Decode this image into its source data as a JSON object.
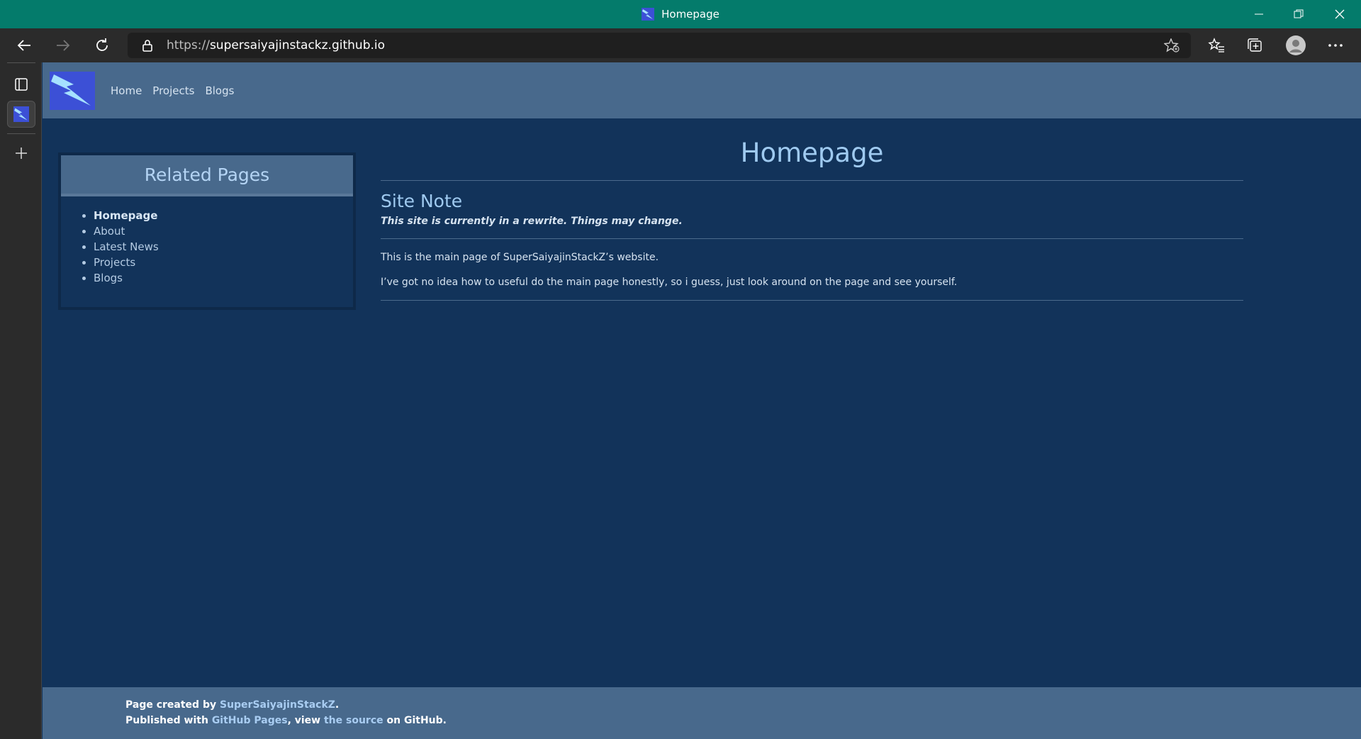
{
  "window": {
    "title": "Homepage",
    "controls": {
      "minimize": "minimize",
      "restore": "restore",
      "close": "close"
    }
  },
  "browser": {
    "url_scheme": "https://",
    "url_host": "supersaiyajinstackz.github.io",
    "icons": [
      "back-icon",
      "forward-icon",
      "refresh-icon",
      "lock-icon",
      "add-favorite-icon",
      "favorites-icon",
      "collections-icon",
      "profile-icon",
      "more-icon"
    ]
  },
  "site": {
    "nav": [
      "Home",
      "Projects",
      "Blogs"
    ]
  },
  "sidebar": {
    "title": "Related Pages",
    "items": [
      "Homepage",
      "About",
      "Latest News",
      "Projects",
      "Blogs"
    ],
    "current": "Homepage"
  },
  "main": {
    "title": "Homepage",
    "section_title": "Site Note",
    "note": "This site is currently in a rewrite. Things may change.",
    "paragraphs": [
      "This is the main page of SuperSaiyajinStackZ’s website.",
      "I’ve got no idea how to useful do the main page honestly, so i guess, just look around on the page and see yourself."
    ]
  },
  "footer": {
    "line1_prefix": "Page created by ",
    "line1_link": "SuperSaiyajinStackZ",
    "line1_suffix": ".",
    "line2_prefix": "Published with ",
    "line2_link1": "GitHub Pages",
    "line2_mid": ", view ",
    "line2_link2": "the source",
    "line2_suffix": " on GitHub."
  },
  "colors": {
    "titlebar": "#047b6b",
    "page_bg": "#12335a",
    "header_bg": "#48698c",
    "heading": "#9fcaf0",
    "logo_bg": "#3c50d6"
  }
}
